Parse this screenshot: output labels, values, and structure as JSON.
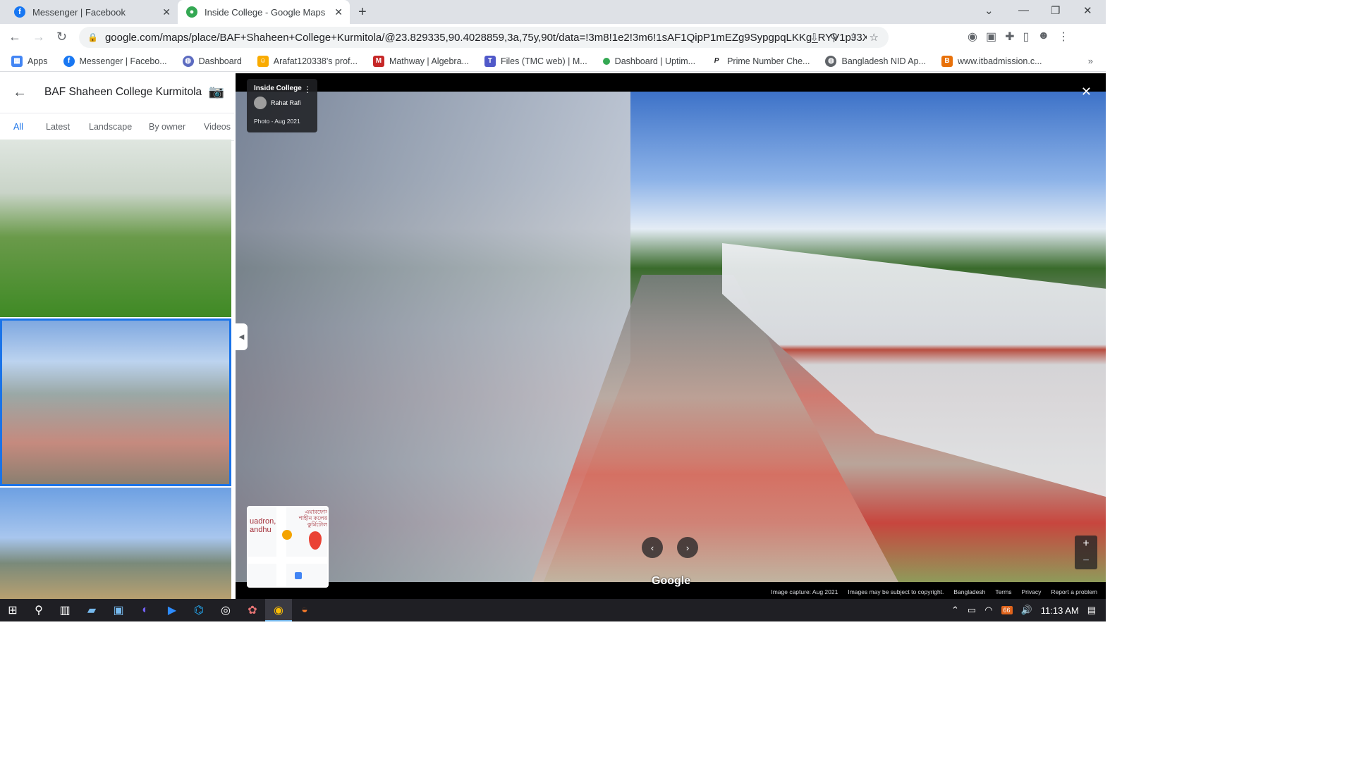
{
  "browser": {
    "tabs": [
      {
        "title": "Messenger | Facebook",
        "icon": "facebook-icon",
        "active": false
      },
      {
        "title": "Inside College - Google Maps",
        "icon": "google-maps-icon",
        "active": true
      }
    ],
    "url": "google.com/maps/place/BAF+Shaheen+College+Kurmitola/@23.829335,90.4028859,3a,75y,90t/data=!3m8!1e2!3m6!1sAF1QipP1mEZg9SypgpqLKKg_RYV1pJ3Xmub5yK3...",
    "bookmarks": [
      {
        "label": "Apps",
        "icon": "apps-grid-icon",
        "color": "#4285f4"
      },
      {
        "label": "Messenger | Facebo...",
        "icon": "facebook-icon",
        "color": "#1877f2"
      },
      {
        "label": "Dashboard",
        "icon": "globe-icon",
        "color": "#5c6bc0"
      },
      {
        "label": "Arafat120338's prof...",
        "icon": "smiley-icon",
        "color": "#f9ab00"
      },
      {
        "label": "Mathway | Algebra...",
        "icon": "mathway-icon",
        "color": "#c62828"
      },
      {
        "label": "Files (TMC web) | M...",
        "icon": "teams-icon",
        "color": "#5059c9"
      },
      {
        "label": "Dashboard | Uptim...",
        "icon": "uptime-icon",
        "color": "#34a853"
      },
      {
        "label": "Prime Number Che...",
        "icon": "p-icon",
        "color": "#202124"
      },
      {
        "label": "Bangladesh NID Ap...",
        "icon": "globe-icon",
        "color": "#5f6368"
      },
      {
        "label": "www.itbadmission.c...",
        "icon": "itb-icon",
        "color": "#e8710a"
      }
    ]
  },
  "sidepanel": {
    "title": "BAF Shaheen College Kurmitola",
    "tabs": [
      {
        "label": "All",
        "active": true
      },
      {
        "label": "Latest",
        "active": false
      },
      {
        "label": "Landscape",
        "active": false
      },
      {
        "label": "By owner",
        "active": false
      },
      {
        "label": "Videos",
        "active": false
      }
    ]
  },
  "viewer": {
    "photo_title": "Inside College",
    "author": "Rahat Rafi",
    "photo_date": "Photo - Aug 2021",
    "google_logo": "Google",
    "minimap": {
      "label_left": "uadron,\nandhu",
      "label_right": "এয়ারফোর্স\nশাহীন কলেজ\nকুর্মিটোলা"
    },
    "footer": [
      "Image capture: Aug 2021",
      "Images may be subject to copyright.",
      "Bangladesh",
      "Terms",
      "Privacy",
      "Report a problem"
    ]
  },
  "taskbar": {
    "clock": "11:13 AM",
    "tray_badge": "66"
  }
}
